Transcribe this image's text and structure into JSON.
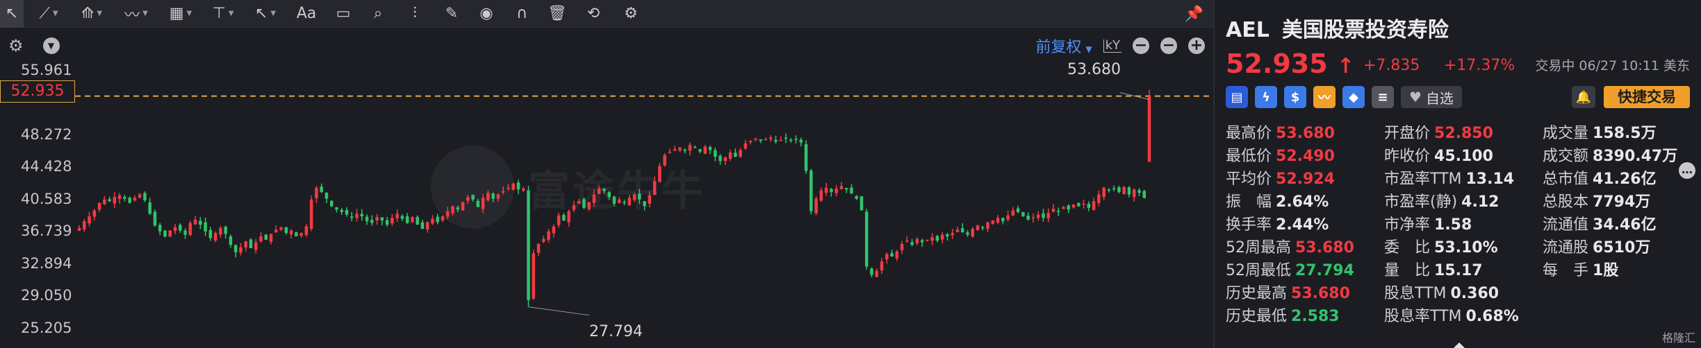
{
  "toolbar": {
    "items": [
      {
        "name": "cursor-tool",
        "icon": "cursor-icon",
        "glyph": "↖",
        "active": true,
        "caret": false
      },
      {
        "name": "line-tool",
        "icon": "line-icon",
        "glyph": "⟋",
        "caret": true
      },
      {
        "name": "channel-tool",
        "icon": "channel-icon",
        "glyph": "⟰",
        "caret": true
      },
      {
        "name": "wave-tool",
        "icon": "wave-icon",
        "glyph": "〰",
        "caret": true
      },
      {
        "name": "fib-tool",
        "icon": "fib-grid-icon",
        "glyph": "▦",
        "caret": true
      },
      {
        "name": "measure-tool",
        "icon": "measure-icon",
        "glyph": "⊤",
        "caret": true
      },
      {
        "name": "arrow-tool",
        "icon": "arrow-icon",
        "glyph": "↖",
        "caret": true
      },
      {
        "name": "text-tool",
        "icon": "text-icon",
        "glyph": "Aa",
        "caret": false
      },
      {
        "name": "comment-tool",
        "icon": "comment-icon",
        "glyph": "▭",
        "caret": false
      },
      {
        "name": "zoom-tool",
        "icon": "magnifier-icon",
        "glyph": "⌕",
        "caret": false
      },
      {
        "name": "indicator-tool",
        "icon": "indicator-icon",
        "glyph": "⫶",
        "caret": false
      },
      {
        "name": "brush-tool",
        "icon": "brush-icon",
        "glyph": "✎",
        "caret": false
      },
      {
        "name": "visibility-tool",
        "icon": "eye-icon",
        "glyph": "◉",
        "caret": false
      },
      {
        "name": "magnet-tool",
        "icon": "magnet-icon",
        "glyph": "∩",
        "caret": false
      },
      {
        "name": "delete-tool",
        "icon": "trash-icon",
        "glyph": "🗑",
        "caret": false
      },
      {
        "name": "sync-tool",
        "icon": "sync-icon",
        "glyph": "⟲",
        "caret": false
      },
      {
        "name": "settings-tool",
        "icon": "gear-icon",
        "glyph": "⚙",
        "caret": false
      }
    ]
  },
  "subbar": {
    "adjust_label": "前复权"
  },
  "chart_data": {
    "type": "candlestick",
    "y_ticks": [
      "55.961",
      "48.272",
      "44.428",
      "40.583",
      "36.739",
      "32.894",
      "29.050",
      "25.205"
    ],
    "y_tick_values": [
      55.961,
      48.272,
      44.428,
      40.583,
      36.739,
      32.894,
      29.05,
      25.205
    ],
    "ylim": [
      25.205,
      55.961
    ],
    "current_price": "52.935",
    "current_price_value": 52.935,
    "high_annotation": "53.680",
    "high_value": 53.68,
    "low_annotation": "27.794",
    "low_value": 27.794,
    "closes": [
      37.2,
      38.0,
      38.6,
      39.3,
      40.2,
      40.6,
      40.4,
      40.9,
      41.1,
      40.7,
      40.2,
      40.8,
      41.2,
      40.5,
      38.9,
      37.5,
      36.8,
      36.2,
      36.9,
      37.3,
      36.9,
      36.4,
      37.8,
      38.2,
      37.6,
      36.8,
      36.0,
      36.6,
      37.2,
      36.5,
      35.2,
      34.3,
      34.9,
      35.6,
      34.8,
      35.5,
      36.2,
      35.8,
      36.5,
      37.0,
      37.3,
      36.6,
      36.9,
      36.2,
      36.6,
      37.4,
      40.6,
      42.0,
      41.5,
      40.7,
      39.8,
      39.4,
      39.1,
      38.8,
      38.4,
      38.9,
      38.6,
      38.0,
      37.8,
      38.5,
      38.1,
      37.6,
      38.4,
      38.9,
      38.3,
      37.8,
      38.5,
      37.6,
      37.1,
      37.9,
      38.3,
      37.9,
      38.6,
      39.2,
      39.8,
      39.4,
      40.3,
      40.9,
      40.6,
      39.7,
      40.8,
      41.4,
      40.7,
      41.2,
      41.6,
      42.0,
      42.5,
      41.8,
      41.9,
      28.6,
      34.2,
      35.3,
      35.9,
      36.8,
      37.4,
      38.7,
      38.1,
      39.2,
      39.9,
      40.4,
      39.6,
      40.3,
      41.2,
      41.9,
      41.6,
      40.9,
      40.1,
      40.6,
      40.2,
      40.8,
      41.2,
      40.6,
      39.8,
      41.1,
      42.8,
      44.6,
      45.9,
      46.3,
      46.6,
      46.8,
      46.4,
      47.1,
      46.8,
      46.3,
      46.9,
      46.5,
      45.7,
      45.2,
      45.6,
      46.2,
      45.7,
      46.5,
      47.3,
      47.6,
      47.9,
      47.6,
      47.8,
      48.0,
      47.5,
      47.7,
      47.9,
      47.6,
      47.8,
      47.4,
      44.0,
      39.2,
      40.7,
      41.7,
      42.0,
      41.5,
      41.9,
      42.2,
      41.8,
      41.3,
      40.7,
      39.3,
      32.6,
      31.6,
      32.1,
      33.2,
      34.1,
      33.8,
      34.4,
      35.3,
      35.7,
      35.2,
      35.9,
      35.5,
      35.8,
      36.1,
      35.7,
      36.4,
      36.2,
      36.6,
      37.0,
      36.7,
      36.4,
      37.1,
      37.5,
      37.2,
      37.9,
      38.1,
      38.4,
      38.0,
      38.7,
      39.3,
      39.1,
      38.6,
      38.2,
      38.5,
      38.8,
      38.4,
      39.0,
      39.5,
      39.2,
      39.7,
      39.4,
      40.0,
      39.8,
      40.1,
      39.6,
      40.4,
      41.2,
      42.0,
      41.7,
      41.9,
      41.5,
      42.1,
      41.2,
      41.8,
      41.4,
      40.8,
      52.935
    ],
    "series_colors": {
      "up": "#f23a43",
      "down": "#2fc56c",
      "dashed": "#e0a84b"
    }
  },
  "quote": {
    "ticker": "AEL",
    "name": "美国股票投资寿险",
    "price": "52.935",
    "arrow": "↑",
    "change": "+7.835",
    "change_pct": "+17.37%",
    "status": "交易中 06/27 10:11 美东",
    "watch_label": "自选",
    "trade_label": "快捷交易",
    "badges": [
      {
        "name": "us-flag-badge",
        "icon": "flag-icon",
        "glyph": "▤",
        "color": "#2c5bd7"
      },
      {
        "name": "lightning-badge",
        "icon": "lightning-icon",
        "glyph": "ϟ",
        "color": "#3a7be8"
      },
      {
        "name": "dollar-badge",
        "icon": "dollar-icon",
        "glyph": "$",
        "color": "#3a7be8"
      },
      {
        "name": "trend-badge",
        "icon": "trend-icon",
        "glyph": "〰",
        "color": "#f0a02a"
      },
      {
        "name": "tag-badge",
        "icon": "tag-icon",
        "glyph": "◆",
        "color": "#3a7be8"
      },
      {
        "name": "doc-badge",
        "icon": "document-icon",
        "glyph": "≡",
        "color": "#55565d"
      }
    ],
    "stats": [
      [
        {
          "k": "最高价",
          "v": "53.680",
          "c": "up"
        },
        {
          "k": "开盘价",
          "v": "52.850",
          "c": "up"
        },
        {
          "k": "成交量",
          "v": "158.5万",
          "c": ""
        }
      ],
      [
        {
          "k": "最低价",
          "v": "52.490",
          "c": "up"
        },
        {
          "k": "昨收价",
          "v": "45.100",
          "c": ""
        },
        {
          "k": "成交额",
          "v": "8390.47万",
          "c": ""
        }
      ],
      [
        {
          "k": "平均价",
          "v": "52.924",
          "c": "up"
        },
        {
          "k": "市盈率TTM",
          "v": "13.14",
          "c": ""
        },
        {
          "k": "总市值",
          "v": "41.26亿",
          "c": ""
        }
      ],
      [
        {
          "k": "振　幅",
          "v": "2.64%",
          "c": ""
        },
        {
          "k": "市盈率(静)",
          "v": "4.12",
          "c": ""
        },
        {
          "k": "总股本",
          "v": "7794万",
          "c": ""
        }
      ],
      [
        {
          "k": "换手率",
          "v": "2.44%",
          "c": ""
        },
        {
          "k": "市净率",
          "v": "1.58",
          "c": ""
        },
        {
          "k": "流通值",
          "v": "34.46亿",
          "c": ""
        }
      ],
      [
        {
          "k": "52周最高",
          "v": "53.680",
          "c": "up"
        },
        {
          "k": "委　比",
          "v": "53.10%",
          "c": ""
        },
        {
          "k": "流通股",
          "v": "6510万",
          "c": ""
        }
      ],
      [
        {
          "k": "52周最低",
          "v": "27.794",
          "c": "down"
        },
        {
          "k": "量　比",
          "v": "15.17",
          "c": ""
        },
        {
          "k": "每　手",
          "v": "1股",
          "c": ""
        }
      ],
      [
        {
          "k": "历史最高",
          "v": "53.680",
          "c": "up"
        },
        {
          "k": "股息TTM",
          "v": "0.360",
          "c": ""
        },
        {
          "k": "",
          "v": "",
          "c": ""
        }
      ],
      [
        {
          "k": "历史最低",
          "v": "2.583",
          "c": "down"
        },
        {
          "k": "股息率TTM",
          "v": "0.68%",
          "c": ""
        },
        {
          "k": "",
          "v": "",
          "c": ""
        }
      ]
    ],
    "footer_logo": "格隆汇"
  }
}
